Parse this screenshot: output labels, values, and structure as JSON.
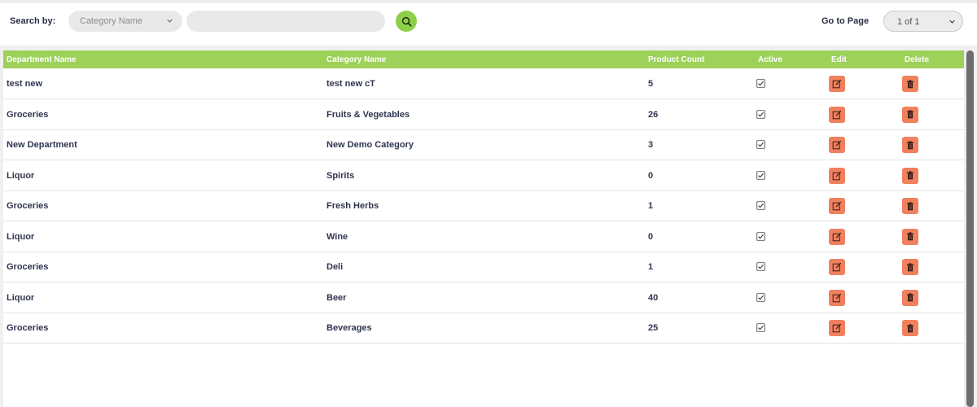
{
  "toolbar": {
    "search_by_label": "Search by:",
    "search_field_selected": "Category Name",
    "search_input_value": "",
    "search_input_placeholder": "",
    "search_button_icon": "search-icon",
    "go_to_page_label": "Go to Page",
    "page_selected": "1 of 1"
  },
  "table": {
    "headers": {
      "department": "Department Name",
      "category": "Category Name",
      "count": "Product Count",
      "active": "Active",
      "edit": "Edit",
      "delete": "Delete"
    },
    "rows": [
      {
        "department": "test new",
        "category": "test new cT",
        "count": "5",
        "active": true
      },
      {
        "department": "Groceries",
        "category": "Fruits & Vegetables",
        "count": "26",
        "active": true
      },
      {
        "department": "New Department",
        "category": "New Demo Category",
        "count": "3",
        "active": true
      },
      {
        "department": "Liquor",
        "category": "Spirits",
        "count": "0",
        "active": true
      },
      {
        "department": "Groceries",
        "category": "Fresh Herbs",
        "count": "1",
        "active": true
      },
      {
        "department": "Liquor",
        "category": "Wine",
        "count": "0",
        "active": true
      },
      {
        "department": "Groceries",
        "category": "Deli",
        "count": "1",
        "active": true
      },
      {
        "department": "Liquor",
        "category": "Beer",
        "count": "40",
        "active": true
      },
      {
        "department": "Groceries",
        "category": "Beverages",
        "count": "25",
        "active": true
      }
    ]
  },
  "colors": {
    "header_green": "#9dd15a",
    "search_button": "#8ecf4a",
    "action_button": "#f0805e",
    "text_dark": "#2f3550"
  },
  "icons": {
    "active": "checkbox-checked-icon",
    "edit": "edit-icon",
    "delete": "trash-icon"
  }
}
